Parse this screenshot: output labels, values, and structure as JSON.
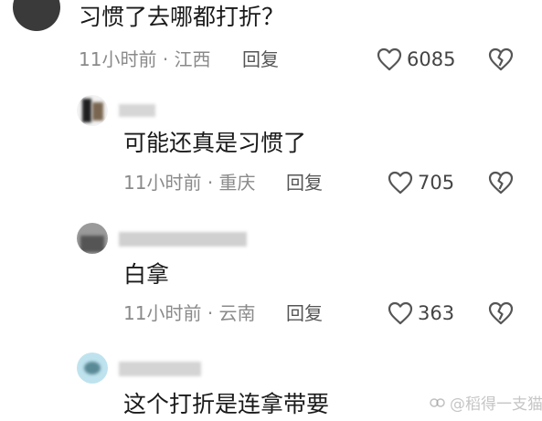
{
  "comments": [
    {
      "text": "习惯了去哪都打折？",
      "time": "11小时前",
      "location": "江西",
      "reply": "回复",
      "likes": "6085"
    },
    {
      "text": "可能还真是习惯了",
      "time": "11小时前",
      "location": "重庆",
      "reply": "回复",
      "likes": "705"
    },
    {
      "text": "白拿",
      "time": "11小时前",
      "location": "云南",
      "reply": "回复",
      "likes": "363"
    },
    {
      "text": "这个打折是连拿带要"
    }
  ],
  "meta_separator": "·",
  "watermark": {
    "handle": "@稻得一支猫"
  },
  "icons": {
    "like": "heart-outline-icon",
    "dislike": "broken-heart-icon"
  },
  "colors": {
    "text": "#1a1a1a",
    "meta": "#8a8a8a",
    "icon": "#555555"
  }
}
